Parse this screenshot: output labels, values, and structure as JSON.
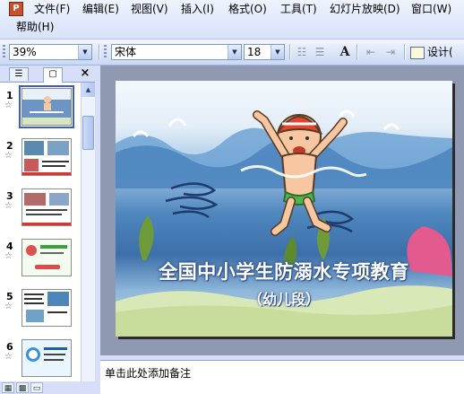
{
  "menu": {
    "items": [
      "文件(F)",
      "编辑(E)",
      "视图(V)",
      "插入(I)",
      "格式(O)",
      "工具(T)",
      "幻灯片放映(D)",
      "窗口(W)",
      "帮助(H)"
    ]
  },
  "toolbar": {
    "zoom": "39%",
    "font_name": "宋体",
    "font_size": "18",
    "design_label": "设计(",
    "grow_font_glyph": "A",
    "icons": [
      "numbering-icon",
      "bullets-icon",
      "grow-font-icon",
      "decrease-indent-icon",
      "increase-indent-icon",
      "design-icon"
    ]
  },
  "left_panel": {
    "tab_outline_glyph": "☰",
    "tab_slides_glyph": "▢",
    "close_glyph": "×",
    "slides": [
      {
        "number": "1",
        "star": "☆",
        "selected": true
      },
      {
        "number": "2",
        "star": "☆",
        "selected": false
      },
      {
        "number": "3",
        "star": "☆",
        "selected": false
      },
      {
        "number": "4",
        "star": "☆",
        "selected": false
      },
      {
        "number": "5",
        "star": "☆",
        "selected": false
      },
      {
        "number": "6",
        "star": "☆",
        "selected": false
      }
    ]
  },
  "slide": {
    "title": "全国中小学生防溺水专项教育",
    "subtitle": "（幼儿段）"
  },
  "notes": {
    "placeholder": "单击此处添加备注"
  },
  "colors": {
    "chrome": "#d6dff7",
    "slide_area": "#8f9ab2",
    "selection": "#3c5fbf",
    "title_outline": "#2c4e86"
  }
}
